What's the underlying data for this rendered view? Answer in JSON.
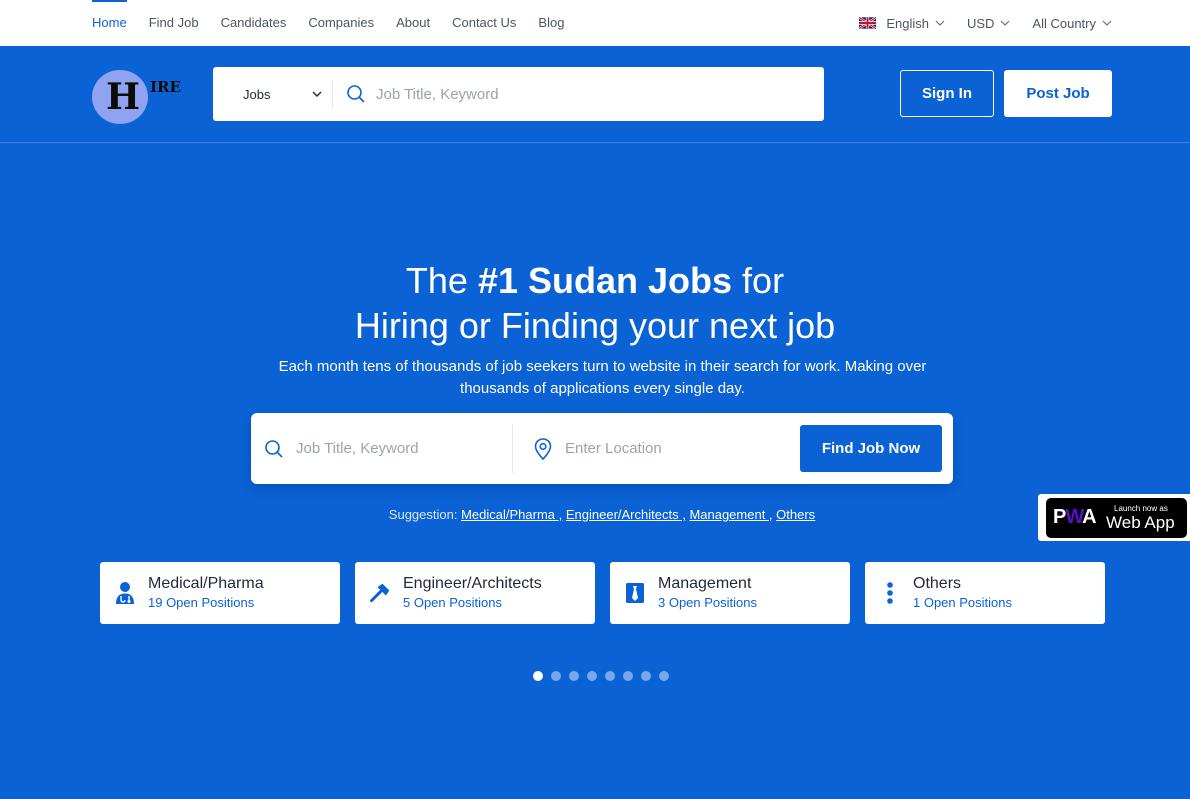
{
  "topbar": {
    "nav": [
      "Home",
      "Find Job",
      "Candidates",
      "Companies",
      "About",
      "Contact Us",
      "Blog"
    ],
    "language": "English",
    "currency": "USD",
    "country": "All Country"
  },
  "header": {
    "logo_letter": "H",
    "logo_rest": "IRE",
    "category": "Jobs",
    "search_placeholder": "Job Title, Keyword",
    "sign_in": "Sign In",
    "post_job": "Post Job"
  },
  "hero": {
    "title_pre": "The ",
    "title_bold": "#1 Sudan Jobs",
    "title_post": " for",
    "title_line2": "Hiring or Finding your next job",
    "subtitle": "Each month tens of thousands of job seekers turn to website in their search for work. Making over thousands of applications every single day.",
    "keyword_placeholder": "Job Title, Keyword",
    "location_placeholder": "Enter Location",
    "find_button": "Find Job Now"
  },
  "suggestion": {
    "label": "Suggestion: ",
    "links": [
      "Medical/Pharma ,",
      "Engineer/Architects ,",
      "Management ,",
      "Others"
    ]
  },
  "categories": [
    {
      "title": "Medical/Pharma",
      "count": "19 Open Positions",
      "icon": "doctor-icon"
    },
    {
      "title": "Engineer/Architects",
      "count": "5 Open Positions",
      "icon": "hammer-icon"
    },
    {
      "title": "Management",
      "count": "3 Open Positions",
      "icon": "tie-icon"
    },
    {
      "title": "Others",
      "count": "1 Open Positions",
      "icon": "dots-vertical-icon"
    }
  ],
  "carousel": {
    "total": 8,
    "active": 1
  },
  "pwa": {
    "logo_p": "P",
    "logo_w": "W",
    "logo_a": "A",
    "small": "Launch now as",
    "big": "Web App"
  },
  "colors": {
    "primary": "#0a62d5",
    "white": "#ffffff"
  }
}
